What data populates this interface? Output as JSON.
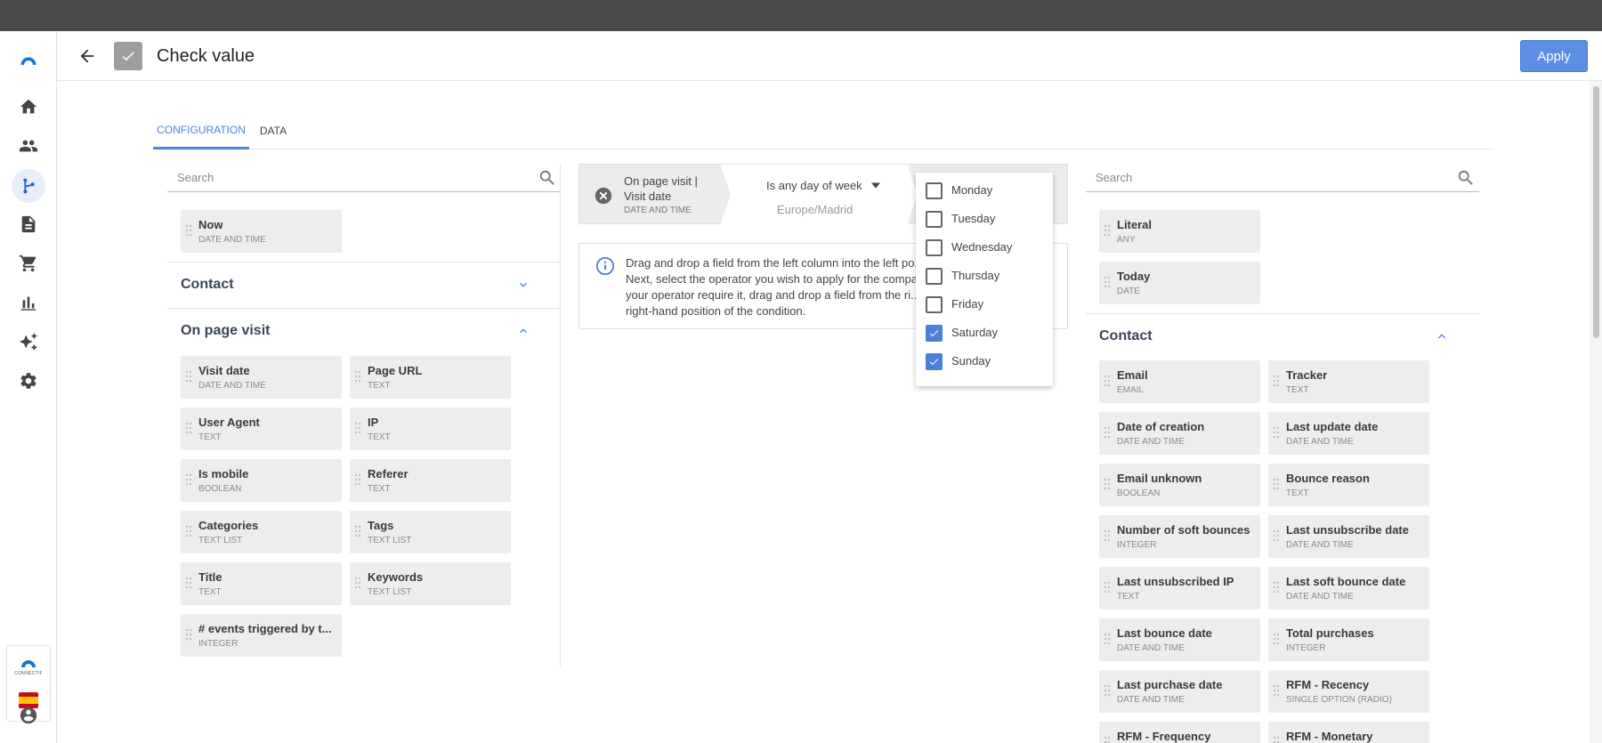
{
  "window": {
    "dots": [
      {
        "name": "window-dot-white",
        "color": "#ffffff"
      },
      {
        "name": "window-dot-lightblue",
        "color": "#a9d4f2"
      },
      {
        "name": "window-dot-blue",
        "color": "#1488e0"
      }
    ]
  },
  "colors": {
    "accent": "#4f82d9",
    "apply_bg": "#5c8ee6",
    "chip_bg": "#ededed",
    "checkbox_checked": "#4a7fdc"
  },
  "sidebar": {
    "items": [
      {
        "name": "home-icon",
        "active": false
      },
      {
        "name": "contacts-icon",
        "active": false
      },
      {
        "name": "workflow-icon",
        "active": true
      },
      {
        "name": "document-icon",
        "active": false
      },
      {
        "name": "cart-icon",
        "active": false
      },
      {
        "name": "analytics-icon",
        "active": false
      },
      {
        "name": "ai-sparkle-icon",
        "active": false
      },
      {
        "name": "settings-icon",
        "active": false
      }
    ],
    "brand_small": "CONNECTIF",
    "language": "es",
    "account_icon": "account-icon"
  },
  "header": {
    "title": "Check value",
    "apply_label": "Apply"
  },
  "tabs": [
    {
      "label": "CONFIGURATION",
      "active": true
    },
    {
      "label": "DATA",
      "active": false
    }
  ],
  "left": {
    "search_placeholder": "Search",
    "top_fields": [
      {
        "name": "Now",
        "type": "DATE AND TIME"
      }
    ],
    "sections": [
      {
        "title": "Contact",
        "expanded": false,
        "fields": []
      },
      {
        "title": "On page visit",
        "expanded": true,
        "fields": [
          {
            "name": "Visit date",
            "type": "DATE AND TIME"
          },
          {
            "name": "Page URL",
            "type": "TEXT"
          },
          {
            "name": "User Agent",
            "type": "TEXT"
          },
          {
            "name": "IP",
            "type": "TEXT"
          },
          {
            "name": "Is mobile",
            "type": "BOOLEAN"
          },
          {
            "name": "Referer",
            "type": "TEXT"
          },
          {
            "name": "Categories",
            "type": "TEXT LIST"
          },
          {
            "name": "Tags",
            "type": "TEXT LIST"
          },
          {
            "name": "Title",
            "type": "TEXT"
          },
          {
            "name": "Keywords",
            "type": "TEXT LIST"
          },
          {
            "name": "# events triggered by t...",
            "type": "INTEGER"
          }
        ]
      }
    ]
  },
  "condition": {
    "field": "On page visit | Visit date",
    "field_type": "DATE AND TIME",
    "operator": "Is any day of week",
    "timezone": "Europe/Madrid"
  },
  "info": {
    "text": "Drag and drop a field from the left column into the left po... Next, select the operator you wish to apply for the compa... your operator require it, drag and drop a field from the ri... right-hand position of the condition."
  },
  "days": [
    {
      "label": "Monday",
      "checked": false
    },
    {
      "label": "Tuesday",
      "checked": false
    },
    {
      "label": "Wednesday",
      "checked": false
    },
    {
      "label": "Thursday",
      "checked": false
    },
    {
      "label": "Friday",
      "checked": false
    },
    {
      "label": "Saturday",
      "checked": true
    },
    {
      "label": "Sunday",
      "checked": true
    }
  ],
  "right": {
    "search_placeholder": "Search",
    "top_fields": [
      {
        "name": "Literal",
        "type": "ANY"
      },
      {
        "name": "Today",
        "type": "DATE"
      }
    ],
    "sections": [
      {
        "title": "Contact",
        "expanded": true,
        "fields": [
          {
            "name": "Email",
            "type": "EMAIL"
          },
          {
            "name": "Tracker",
            "type": "TEXT"
          },
          {
            "name": "Date of creation",
            "type": "DATE AND TIME"
          },
          {
            "name": "Last update date",
            "type": "DATE AND TIME"
          },
          {
            "name": "Email unknown",
            "type": "BOOLEAN"
          },
          {
            "name": "Bounce reason",
            "type": "TEXT"
          },
          {
            "name": "Number of soft bounces",
            "type": "INTEGER"
          },
          {
            "name": "Last unsubscribe date",
            "type": "DATE AND TIME"
          },
          {
            "name": "Last unsubscribed IP",
            "type": "TEXT"
          },
          {
            "name": "Last soft bounce date",
            "type": "DATE AND TIME"
          },
          {
            "name": "Last bounce date",
            "type": "DATE AND TIME"
          },
          {
            "name": "Total purchases",
            "type": "INTEGER"
          },
          {
            "name": "Last purchase date",
            "type": "DATE AND TIME"
          },
          {
            "name": "RFM - Recency",
            "type": "SINGLE OPTION (RADIO)"
          },
          {
            "name": "RFM - Frequency",
            "type": ""
          },
          {
            "name": "RFM - Monetary",
            "type": ""
          }
        ]
      }
    ]
  }
}
